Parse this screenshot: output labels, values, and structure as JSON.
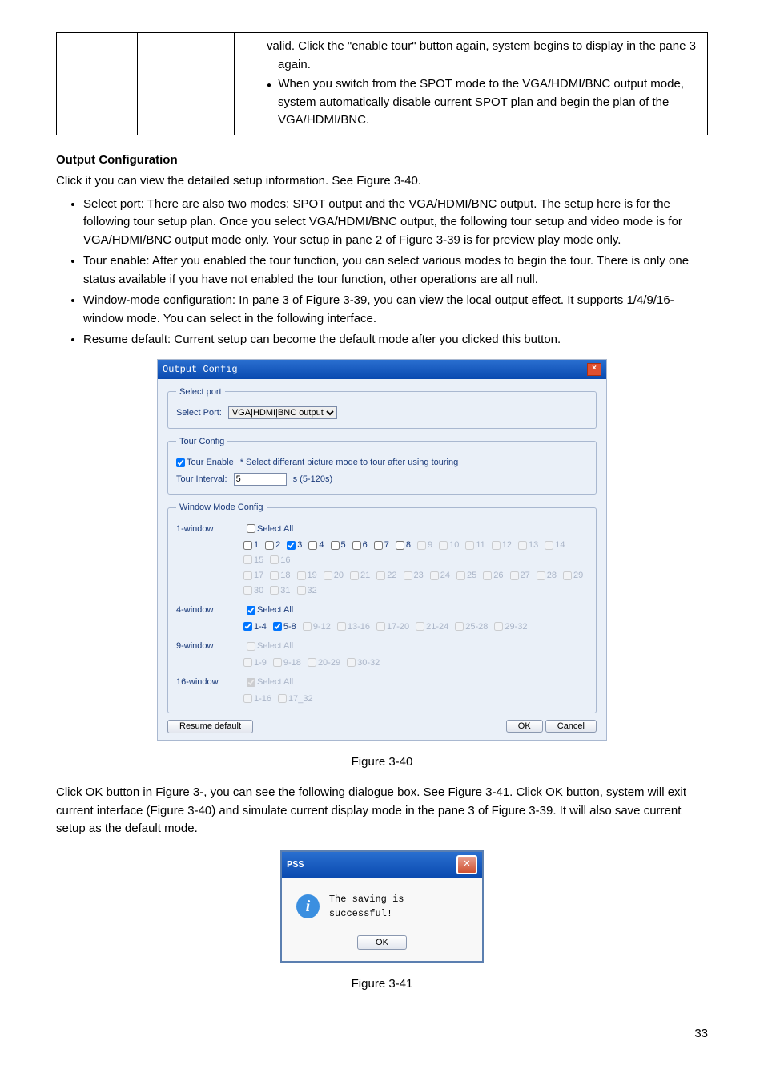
{
  "tableCell": {
    "lines": [
      "valid. Click the \"enable tour\" button again, system begins to display in the pane 3 again.",
      "When you switch from the SPOT mode to the VGA/HDMI/BNC output mode, system automatically disable current SPOT plan and begin the plan of the VGA/HDMI/BNC."
    ]
  },
  "heading": "Output Configuration",
  "intro": "Click it you can view the detailed setup information. See Figure 3-40.",
  "bullets": [
    "Select port: There are also two modes: SPOT output and the VGA/HDMI/BNC output. The setup here is for the following tour setup plan. Once you select VGA/HDMI/BNC output, the following tour setup and video mode is for VGA/HDMI/BNC output mode only. Your setup in pane 2 of Figure 3-39 is for preview play mode only.",
    "Tour enable: After you enabled the tour function, you can select various modes to begin the tour. There is only one status available if you have not enabled the tour function, other operations are all null.",
    "Window-mode configuration: In pane 3 of Figure 3-39, you can view the local output effect. It supports 1/4/9/16-window mode. You can select in the following interface.",
    "Resume default: Current setup can become the default mode after you clicked this button."
  ],
  "dialog": {
    "title": "Output Config",
    "selectPort": {
      "legend": "Select port",
      "label": "Select Port:",
      "value": "VGA|HDMI|BNC output"
    },
    "tourConfig": {
      "legend": "Tour Config",
      "enableLabel": "Tour Enable",
      "enableNote": "* Select differant picture mode to tour after using touring",
      "intervalLabel": "Tour Interval:",
      "intervalValue": "5",
      "intervalUnit": "s    (5-120s)"
    },
    "windowConfig": {
      "legend": "Window Mode Config",
      "w1": {
        "label": "1-window",
        "selectAll": "Select All",
        "row1": [
          "1",
          "2",
          "3",
          "4",
          "5",
          "6",
          "7",
          "8",
          "9",
          "10",
          "11",
          "12",
          "13",
          "14",
          "15",
          "16"
        ],
        "row2": [
          "17",
          "18",
          "19",
          "20",
          "21",
          "22",
          "23",
          "24",
          "25",
          "26",
          "27",
          "28",
          "29",
          "30",
          "31",
          "32"
        ]
      },
      "w4": {
        "label": "4-window",
        "selectAll": "Select All",
        "row": [
          "1-4",
          "5-8",
          "9-12",
          "13-16",
          "17-20",
          "21-24",
          "25-28",
          "29-32"
        ]
      },
      "w9": {
        "label": "9-window",
        "selectAll": "Select All",
        "row": [
          "1-9",
          "9-18",
          "20-29",
          "30-32"
        ]
      },
      "w16": {
        "label": "16-window",
        "selectAll": "Select All",
        "row": [
          "1-16",
          "17_32"
        ]
      }
    },
    "buttons": {
      "resume": "Resume default",
      "ok": "OK",
      "cancel": "Cancel"
    }
  },
  "fig1": "Figure 3-40",
  "para2": "Click OK button in Figure 3-, you can see the following dialogue box. See Figure 3-41. Click OK button, system will exit current interface (Figure 3-40) and simulate current display mode in the pane 3 of Figure 3-39. It will also save current setup as the default mode.",
  "msgbox": {
    "title": "PSS",
    "text": "The saving is successful!",
    "ok": "OK"
  },
  "fig2": "Figure 3-41",
  "page": "33"
}
